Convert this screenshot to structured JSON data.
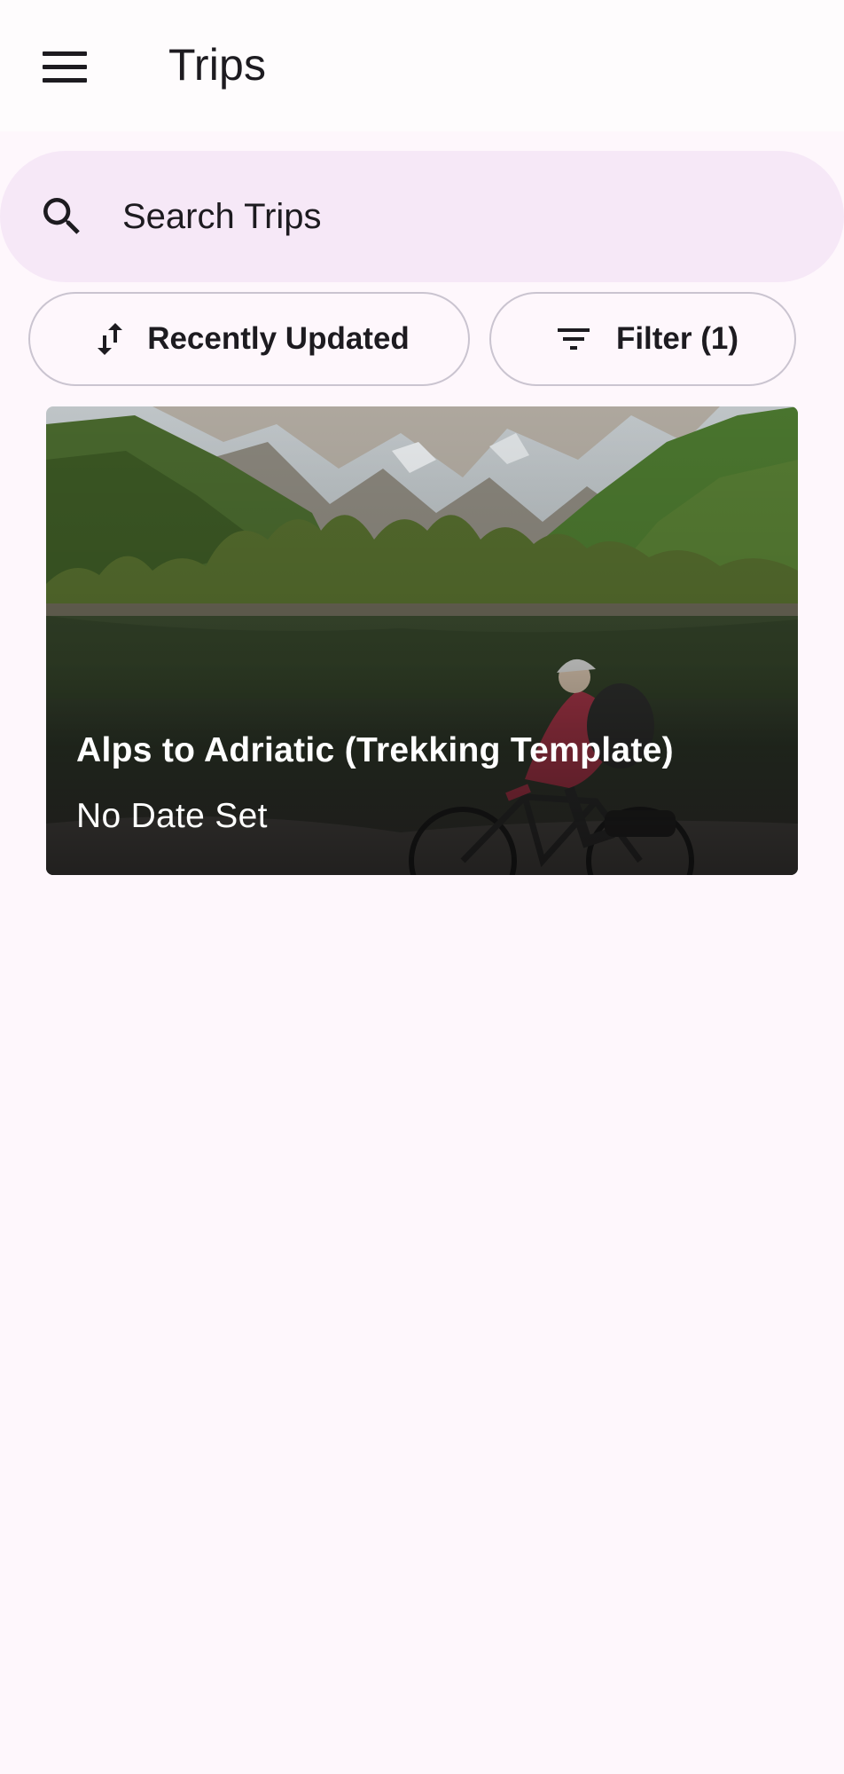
{
  "app_bar": {
    "title": "Trips",
    "menu_icon": "hamburger-menu-icon"
  },
  "search": {
    "placeholder": "Search Trips",
    "icon": "search-icon"
  },
  "chips": {
    "sort": {
      "label": "Recently Updated",
      "icon": "sort-arrows-icon"
    },
    "filter": {
      "label": "Filter (1)",
      "icon": "filter-lines-icon"
    }
  },
  "trips": [
    {
      "title": "Alps to Adriatic (Trekking Template)",
      "subtitle": "No Date Set"
    }
  ],
  "colors": {
    "background": "#fef7fc",
    "search_bar": "#f6e8f7",
    "chip_border": "#cac4d0",
    "text": "#1d1b20"
  }
}
